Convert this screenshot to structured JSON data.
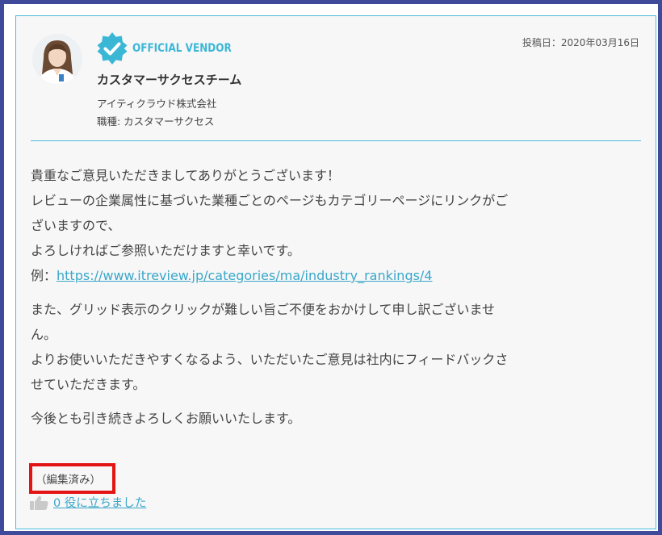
{
  "review_response": {
    "badge_label": "OFFICIAL VENDOR",
    "post_date": "投稿日：2020年03月16日",
    "author_name": "カスタマーサクセスチーム",
    "company": "アイティクラウド株式会社",
    "job_title": "職種: カスタマーサクセス",
    "paragraph1": {
      "line1": "貴重なご意見いただきましてありがとうございます！",
      "line2": "レビューの企業属性に基づいた業種ごとのページもカテゴリーページにリンクがご",
      "line3": "ざいますので、",
      "line4": "よろしければご参照いただけますと幸いです。",
      "example_prefix": "例：",
      "example_link": "https://www.itreview.jp/categories/ma/industry_rankings/4"
    },
    "paragraph2": {
      "line1": "また、グリッド表示のクリックが難しい旨ご不便をおかけして申し訳ございませ",
      "line2": "ん。",
      "line3": "よりお使いいただきやすくなるよう、いただいたご意見は社内にフィードバックさ",
      "line4": "せていただきます。"
    },
    "paragraph3": "今後とも引き続きよろしくお願いいたします。",
    "edited_label": "（編集済み）",
    "helpful_label": " 0 役に立ちました",
    "colors": {
      "accent": "#3bb7d6",
      "frame": "#3f4a9a",
      "highlight": "#e31414"
    },
    "icons": [
      "avatar-photo",
      "verified-badge-icon",
      "thumbs-up-icon"
    ]
  }
}
